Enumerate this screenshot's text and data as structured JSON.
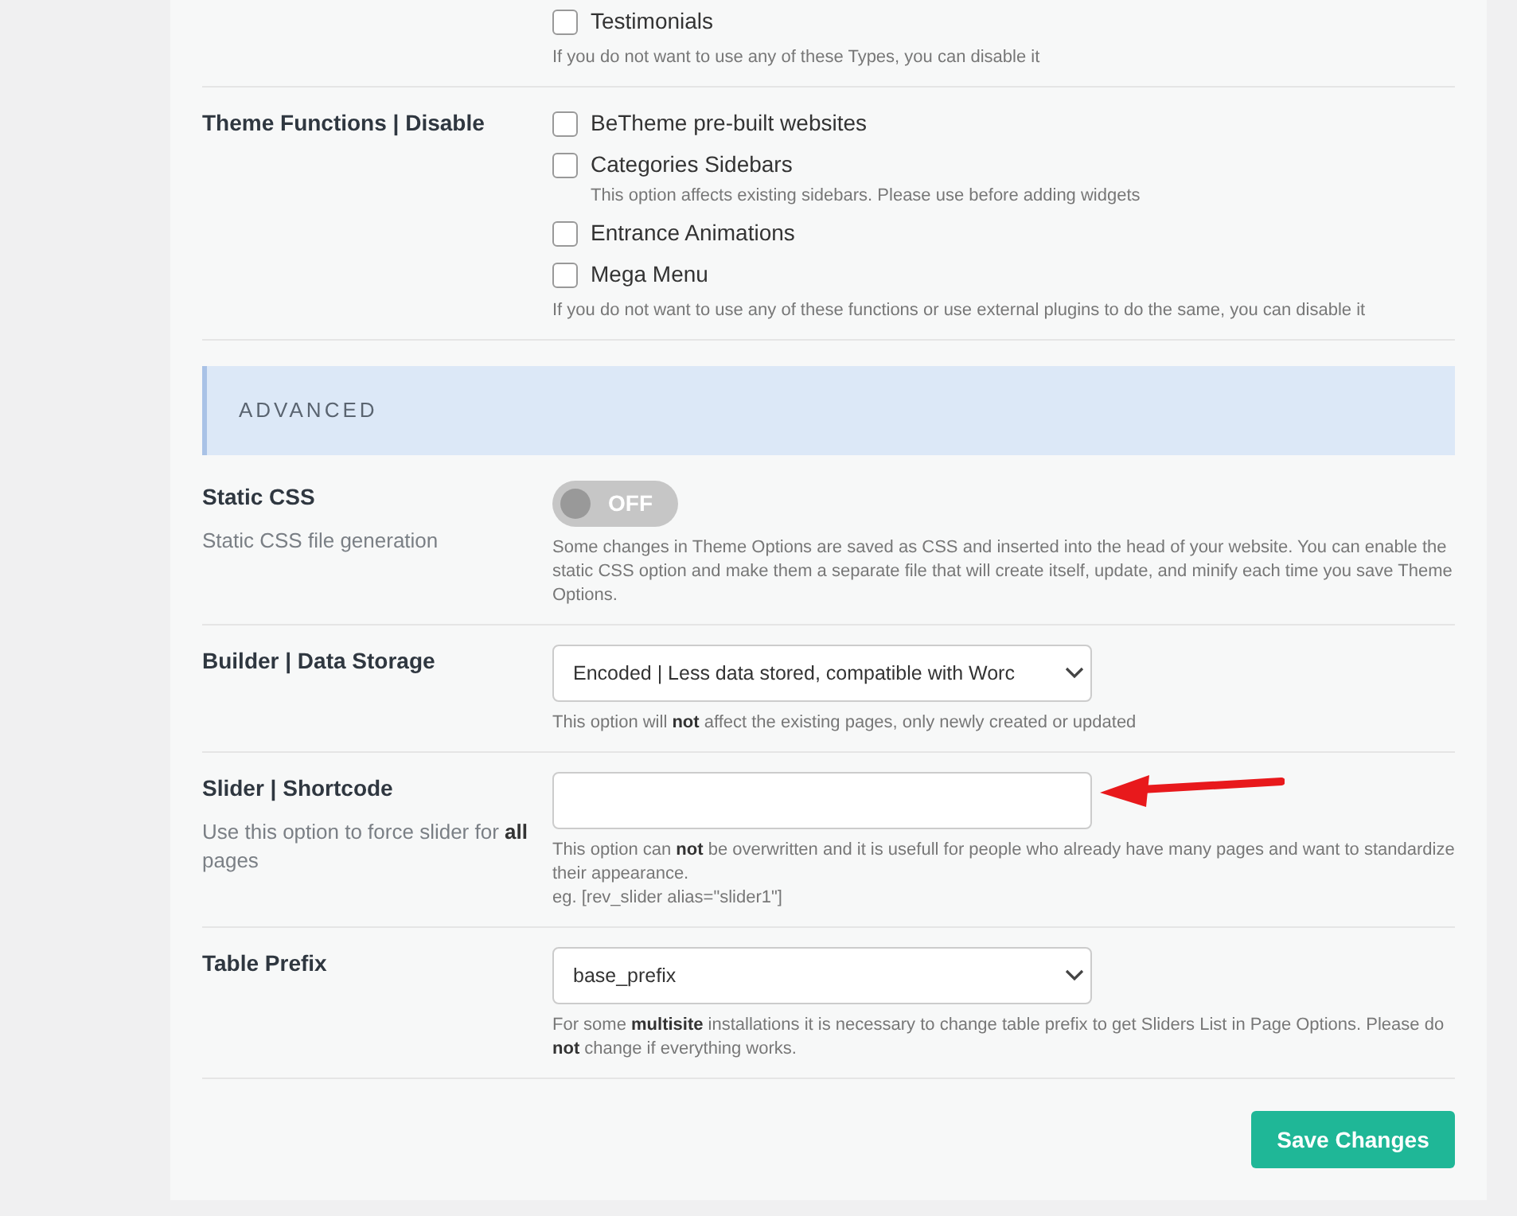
{
  "rows": [
    {
      "kind": "checkboxes",
      "options": [
        {
          "label": "Testimonials",
          "checked": false
        }
      ],
      "description": "If you do not want to use any of these Types, you can disable it"
    },
    {
      "kind": "checkboxes",
      "label": "Theme Functions | Disable",
      "options": [
        {
          "label": "BeTheme pre-built websites",
          "checked": false
        },
        {
          "label": "Categories Sidebars",
          "checked": false,
          "note": "This option affects existing sidebars. Please use before adding widgets"
        },
        {
          "label": "Entrance Animations",
          "checked": false
        },
        {
          "label": "Mega Menu",
          "checked": false
        }
      ],
      "description": "If you do not want to use any of these functions or use external plugins to do the same, you can disable it"
    },
    {
      "kind": "section",
      "title": "ADVANCED"
    },
    {
      "kind": "toggle",
      "label": "Static CSS",
      "sublabel": "Static CSS file generation",
      "on": false,
      "toggle_text": "OFF",
      "description": "Some changes in Theme Options are saved as CSS and inserted into the head of your website. You can enable the static CSS option and make them a separate file that will create itself, update, and minify each time you save Theme Options."
    },
    {
      "kind": "select",
      "label": "Builder | Data Storage",
      "value": "Encoded | Less data stored, compatible with Worc",
      "description": "This option will **not** affect the existing pages, only newly created or updated"
    },
    {
      "kind": "input",
      "label": "Slider | Shortcode",
      "sublabel": "Use this option to force slider for **all** pages",
      "value": "",
      "description": "This option can **not** be overwritten and it is usefull for people who already have many pages and want to standardize their appearance.",
      "example": "eg. [rev_slider alias=\"slider1\"]"
    },
    {
      "kind": "select",
      "label": "Table Prefix",
      "value": "base_prefix",
      "description": "For some **multisite** installations it is necessary to change table prefix to get Sliders List in Page Options. Please do **not** change if everything works."
    }
  ],
  "save_button": "Save Changes"
}
